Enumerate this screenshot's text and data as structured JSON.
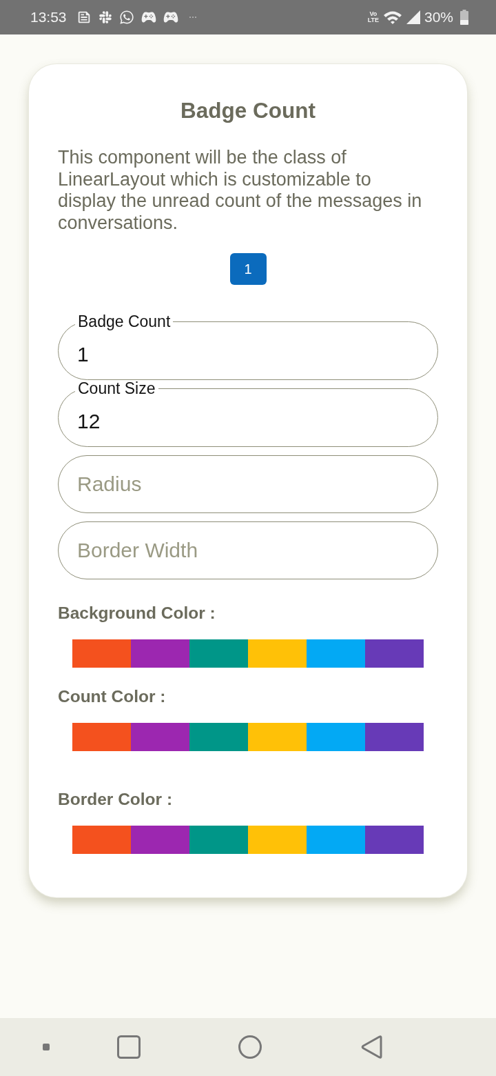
{
  "status_bar": {
    "time": "13:53",
    "network_label": {
      "top": "Vo",
      "bottom": "LTE"
    },
    "battery_text": "30%"
  },
  "card": {
    "title": "Badge Count",
    "description": "This component will be the class of LinearLayout which is customizable to display the unread count of the messages in conversations.",
    "badge": {
      "count": "1"
    },
    "fields": [
      {
        "label": "Badge Count",
        "value": "1"
      },
      {
        "label": "Count Size",
        "value": "12"
      },
      {
        "placeholder": "Radius"
      },
      {
        "placeholder": "Border Width"
      }
    ],
    "palettes": [
      {
        "label": "Background Color :",
        "swatches": [
          {
            "color": "#f4511e"
          },
          {
            "color": "#9c27b0"
          },
          {
            "color": "#009688"
          },
          {
            "color": "#ffc107"
          },
          {
            "color": "#03a9f4"
          },
          {
            "color": "#673ab7"
          }
        ]
      },
      {
        "label": "Count Color :",
        "swatches": [
          {
            "color": "#f4511e"
          },
          {
            "color": "#9c27b0"
          },
          {
            "color": "#009688"
          },
          {
            "color": "#ffc107"
          },
          {
            "color": "#03a9f4"
          },
          {
            "color": "#673ab7"
          }
        ]
      },
      {
        "label": "Border Color :",
        "swatches": [
          {
            "color": "#f4511e"
          },
          {
            "color": "#9c27b0"
          },
          {
            "color": "#009688"
          },
          {
            "color": "#ffc107"
          },
          {
            "color": "#03a9f4"
          },
          {
            "color": "#673ab7"
          }
        ]
      }
    ]
  }
}
